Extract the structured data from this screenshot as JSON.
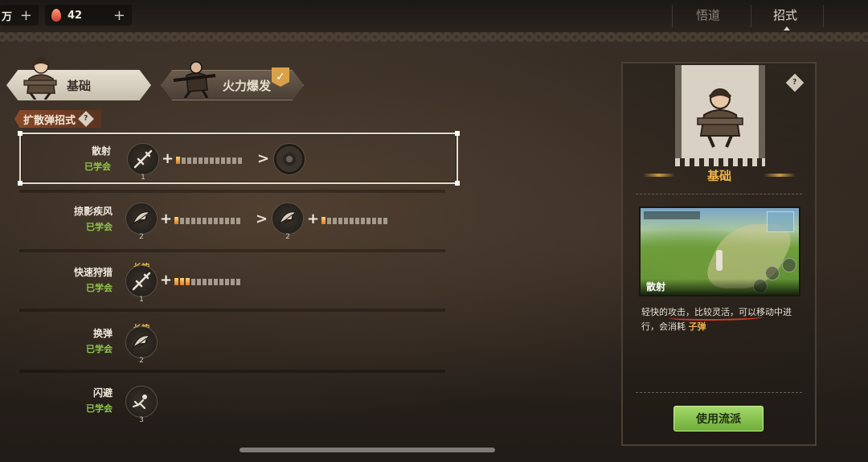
{
  "topbar": {
    "resource1": {
      "value": "万",
      "plus": "+"
    },
    "resource2": {
      "icon": "gem-icon",
      "value": "42",
      "plus": "+"
    },
    "tabs": [
      {
        "label": "悟道",
        "active": false
      },
      {
        "label": "招式",
        "active": true
      }
    ]
  },
  "style_tabs": [
    {
      "label": "基础",
      "selected": true
    },
    {
      "label": "火力爆发",
      "selected": false,
      "badge": "✓"
    }
  ],
  "section": {
    "title": "扩散弹招式",
    "info": "?"
  },
  "skills": [
    {
      "name": "散射",
      "status": "已学会",
      "icon_num": "1",
      "hold": ""
    },
    {
      "name": "掠影疾风",
      "status": "已学会",
      "icon_num": "2",
      "icon_num2": "2",
      "hold": ""
    },
    {
      "name": "快速狩猎",
      "status": "已学会",
      "icon_num": "1",
      "hold": "长按"
    },
    {
      "name": "换弹",
      "status": "已学会",
      "icon_num": "2",
      "hold": "长按"
    },
    {
      "name": "闪避",
      "status": "已学会",
      "icon_num": "3",
      "hold": ""
    }
  ],
  "ui": {
    "plus": "+",
    "arrow": ">"
  },
  "panel": {
    "info": "?",
    "title": "基础",
    "preview_caption": "散射",
    "desc_part1": "轻快的攻击，比较灵活，可以移动中进行，会消耗",
    "desc_highlight": "子弹",
    "use_button": "使用流派"
  },
  "colors": {
    "learned_green": "#8fc84a",
    "gold": "#f0b24a",
    "use_button": "#8cc450"
  }
}
